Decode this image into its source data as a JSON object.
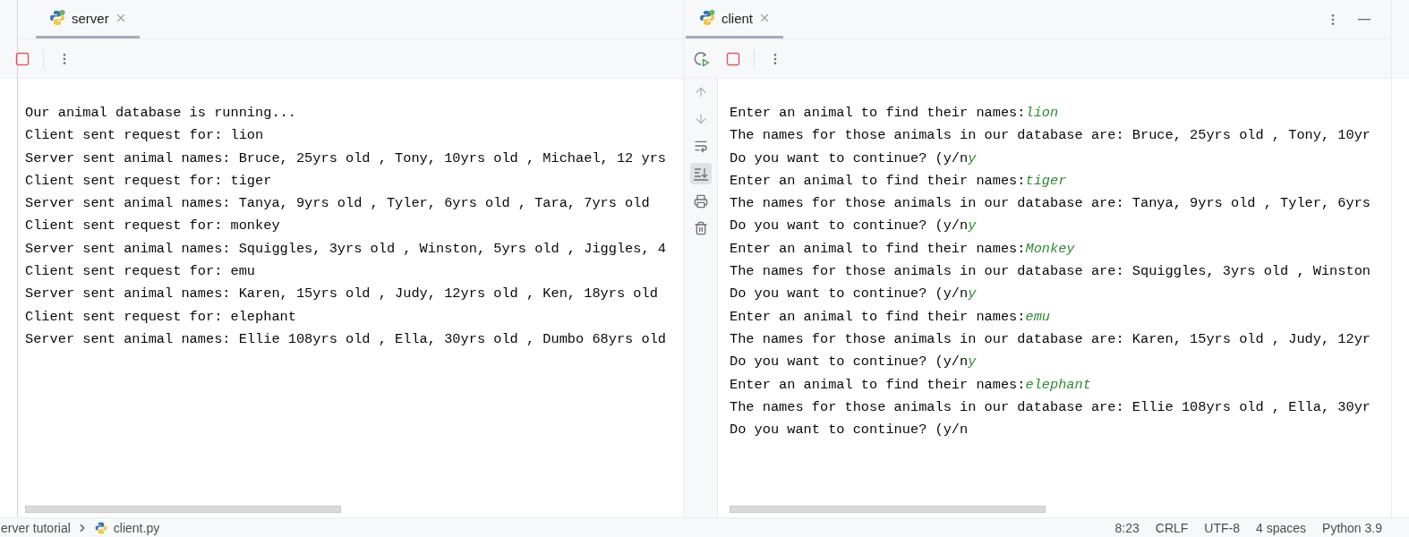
{
  "server_pane": {
    "tab": {
      "label": "server",
      "selected": true
    },
    "lines": [
      {
        "text": "Our animal database is running..."
      },
      {
        "text": "Client sent request for: lion"
      },
      {
        "text": "Server sent animal names: Bruce, 25yrs old , Tony, 10yrs old , Michael, 12 yrs"
      },
      {
        "text": "Client sent request for: tiger"
      },
      {
        "text": "Server sent animal names: Tanya, 9yrs old , Tyler, 6yrs old , Tara, 7yrs old"
      },
      {
        "text": "Client sent request for: monkey"
      },
      {
        "text": "Server sent animal names: Squiggles, 3yrs old , Winston, 5yrs old , Jiggles, 4"
      },
      {
        "text": "Client sent request for: emu"
      },
      {
        "text": "Server sent animal names: Karen, 15yrs old , Judy, 12yrs old , Ken, 18yrs old"
      },
      {
        "text": "Client sent request for: elephant"
      },
      {
        "text": "Server sent animal names: Ellie 108yrs old , Ella, 30yrs old , Dumbo 68yrs old"
      }
    ]
  },
  "client_pane": {
    "tab": {
      "label": "client",
      "selected": true
    },
    "scroll_to_end_on": true,
    "lines": [
      {
        "text": "Enter an animal to find their names:",
        "input": "lion"
      },
      {
        "text": "The names for those animals in our database are: Bruce, 25yrs old , Tony, 10yr"
      },
      {
        "text": "Do you want to continue? (y/n",
        "input": "y"
      },
      {
        "text": "Enter an animal to find their names:",
        "input": "tiger"
      },
      {
        "text": "The names for those animals in our database are: Tanya, 9yrs old , Tyler, 6yrs"
      },
      {
        "text": "Do you want to continue? (y/n",
        "input": "y"
      },
      {
        "text": "Enter an animal to find their names:",
        "input": "Monkey"
      },
      {
        "text": "The names for those animals in our database are: Squiggles, 3yrs old , Winston"
      },
      {
        "text": "Do you want to continue? (y/n",
        "input": "y"
      },
      {
        "text": "Enter an animal to find their names:",
        "input": "emu"
      },
      {
        "text": "The names for those animals in our database are: Karen, 15yrs old , Judy, 12yr"
      },
      {
        "text": "Do you want to continue? (y/n",
        "input": "y"
      },
      {
        "text": "Enter an animal to find their names:",
        "input": "elephant"
      },
      {
        "text": "The names for those animals in our database are: Ellie 108yrs old , Ella, 30yr"
      },
      {
        "text": "Do you want to continue? (y/n"
      }
    ]
  },
  "status_bar": {
    "breadcrumbs": [
      "erver tutorial",
      "client.py"
    ],
    "items": [
      "8:23",
      "CRLF",
      "UTF-8",
      "4 spaces",
      "Python 3.9"
    ]
  }
}
